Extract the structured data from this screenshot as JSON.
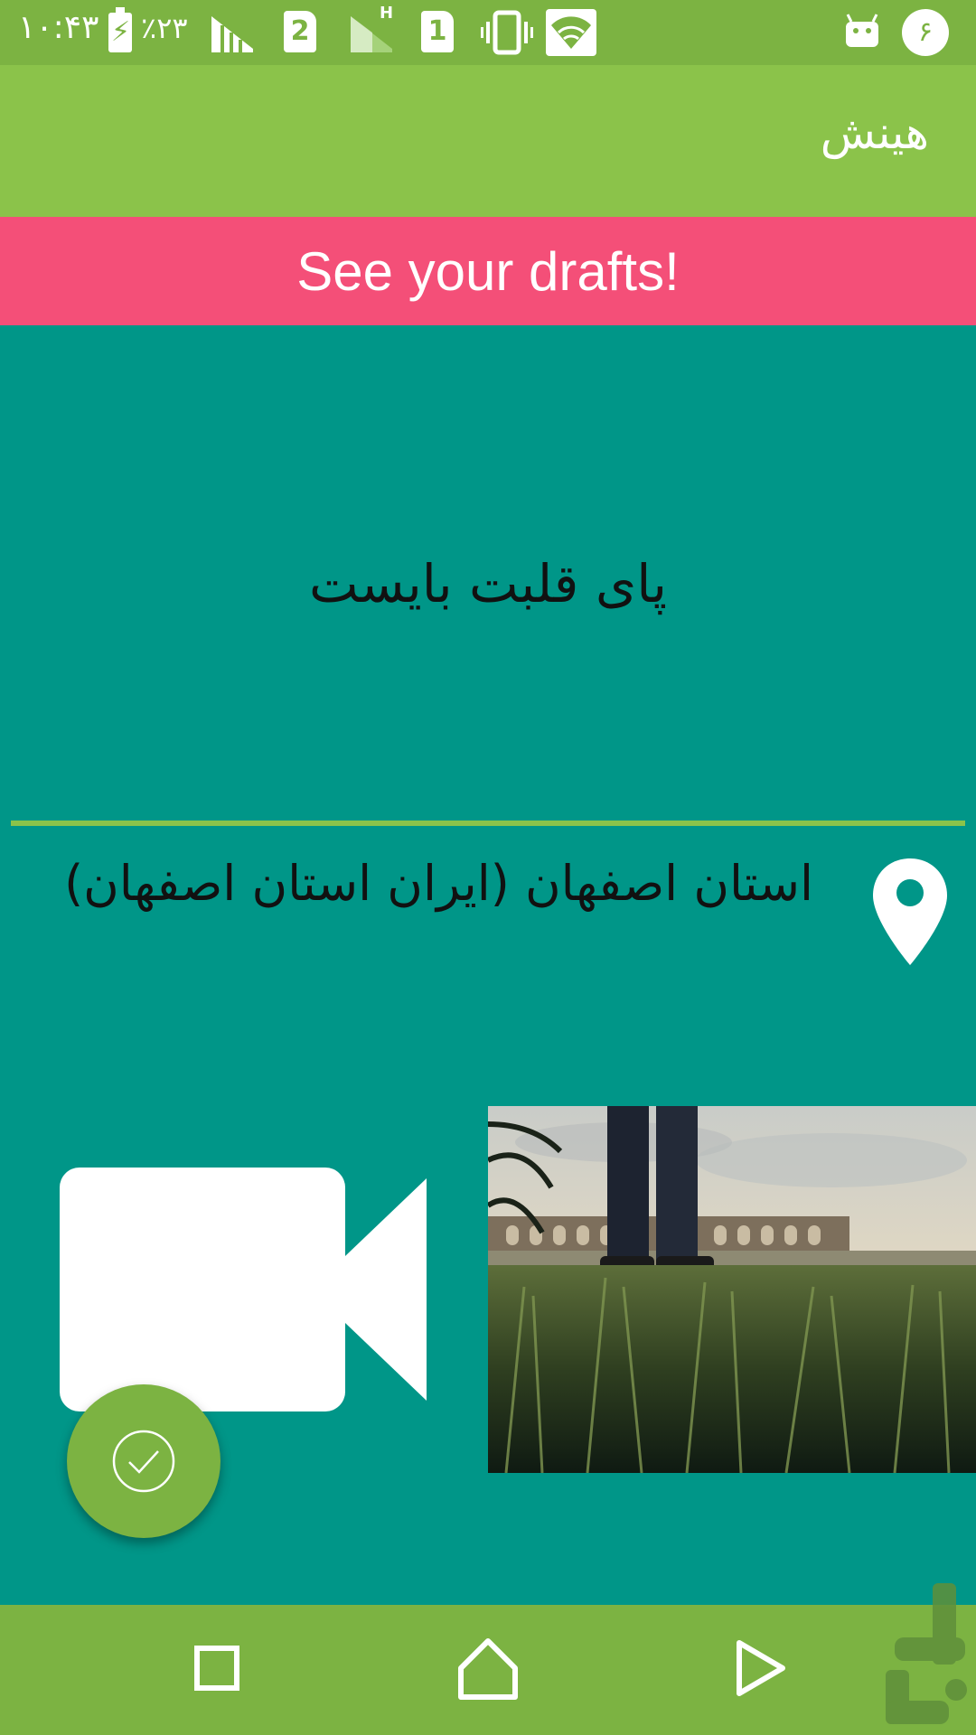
{
  "status_bar": {
    "time": "۱۰:۴۳",
    "battery_percent": "٪۲۳",
    "sim1_label": "2",
    "sim2_label": "1",
    "network_type": "H",
    "notification_count": "۶"
  },
  "app_bar": {
    "title": "هینش"
  },
  "banner": {
    "text": "See your drafts!",
    "color": "#f44f78"
  },
  "post": {
    "text": "پای قلبت بایست",
    "location": "استان اصفهان (ایران استان اصفهان)",
    "location_icon": "location-pin-icon",
    "video_icon": "video-camera-icon",
    "has_photo": true
  },
  "fab": {
    "icon": "check-circle-icon"
  },
  "nav_bar": {
    "items": [
      "recents-square-icon",
      "home-icon",
      "back-triangle-icon"
    ]
  },
  "colors": {
    "primary": "#8bc34a",
    "primary_dark": "#7cb342",
    "background": "#009688",
    "accent": "#f44f78"
  }
}
